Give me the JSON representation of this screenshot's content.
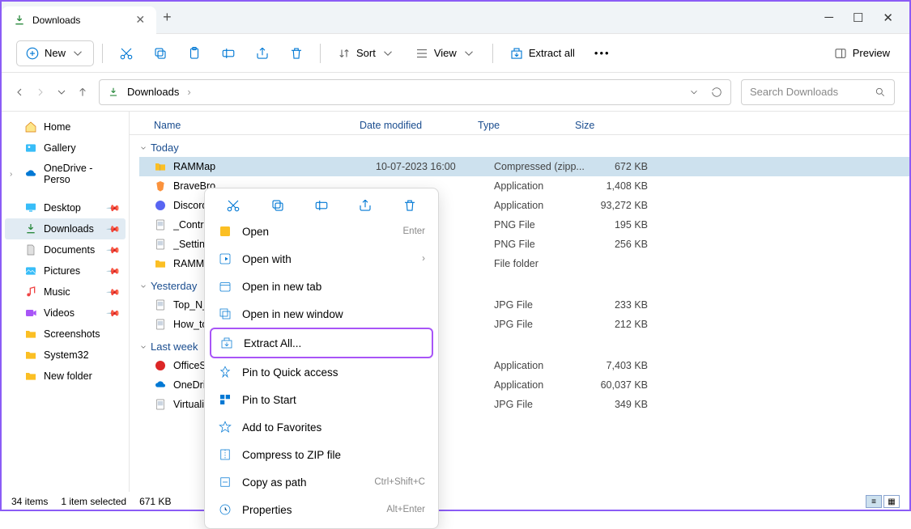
{
  "window": {
    "tab_title": "Downloads",
    "titlebar_controls": {
      "minimize": "─",
      "maximize": "☐",
      "close": "✕"
    }
  },
  "toolbar": {
    "new": "New",
    "sort": "Sort",
    "view": "View",
    "extract_all": "Extract all",
    "preview": "Preview"
  },
  "breadcrumb": {
    "path_seg": "Downloads",
    "arrow": "›"
  },
  "search": {
    "placeholder": "Search Downloads"
  },
  "sidebar": {
    "items": [
      {
        "label": "Home",
        "icon": "home-icon"
      },
      {
        "label": "Gallery",
        "icon": "gallery-icon"
      },
      {
        "label": "OneDrive - Perso",
        "icon": "onedrive-icon",
        "expandable": true
      }
    ],
    "quick": [
      {
        "label": "Desktop",
        "icon": "desktop-icon",
        "pinned": true
      },
      {
        "label": "Downloads",
        "icon": "download-icon",
        "pinned": true,
        "selected": true
      },
      {
        "label": "Documents",
        "icon": "document-icon",
        "pinned": true
      },
      {
        "label": "Pictures",
        "icon": "pictures-icon",
        "pinned": true
      },
      {
        "label": "Music",
        "icon": "music-icon",
        "pinned": true
      },
      {
        "label": "Videos",
        "icon": "videos-icon",
        "pinned": true
      },
      {
        "label": "Screenshots",
        "icon": "folder-icon"
      },
      {
        "label": "System32",
        "icon": "folder-icon"
      },
      {
        "label": "New folder",
        "icon": "folder-icon"
      }
    ]
  },
  "columns": {
    "name": "Name",
    "date": "Date modified",
    "type": "Type",
    "size": "Size"
  },
  "groups": [
    {
      "header": "Today",
      "rows": [
        {
          "name": "RAMMap",
          "date": "10-07-2023 16:00",
          "type": "Compressed (zipp...",
          "size": "672 KB",
          "icon": "zip-icon",
          "selected": true
        },
        {
          "name": "BraveBro",
          "date": "",
          "type": "Application",
          "size": "1,408 KB",
          "icon": "brave-icon"
        },
        {
          "name": "DiscordS",
          "date": "",
          "type": "Application",
          "size": "93,272 KB",
          "icon": "discord-icon"
        },
        {
          "name": "_Controll",
          "date": "",
          "type": "PNG File",
          "size": "195 KB",
          "icon": "png-icon"
        },
        {
          "name": "_Settings",
          "date": "",
          "type": "PNG File",
          "size": "256 KB",
          "icon": "png-icon"
        },
        {
          "name": "RAMMap",
          "date": "",
          "type": "File folder",
          "size": "",
          "icon": "folder-icon"
        }
      ]
    },
    {
      "header": "Yesterday",
      "rows": [
        {
          "name": "Top_N_W",
          "date": "",
          "type": "JPG File",
          "size": "233 KB",
          "icon": "png-icon"
        },
        {
          "name": "How_to_",
          "date": "",
          "type": "JPG File",
          "size": "212 KB",
          "icon": "png-icon"
        }
      ]
    },
    {
      "header": "Last week",
      "rows": [
        {
          "name": "OfficeSet",
          "date": "",
          "type": "Application",
          "size": "7,403 KB",
          "icon": "office-icon"
        },
        {
          "name": "OneDrive",
          "date": "",
          "type": "Application",
          "size": "60,037 KB",
          "icon": "onedrive-icon"
        },
        {
          "name": "Virtualiza",
          "date": "",
          "type": "JPG File",
          "size": "349 KB",
          "icon": "png-icon"
        }
      ]
    }
  ],
  "context_menu": {
    "items": [
      {
        "label": "Open",
        "hint": "Enter",
        "icon": "open-icon"
      },
      {
        "label": "Open with",
        "hint": "›",
        "icon": "openwith-icon"
      },
      {
        "label": "Open in new tab",
        "icon": "newtab-icon"
      },
      {
        "label": "Open in new window",
        "icon": "newwin-icon"
      },
      {
        "label": "Extract All...",
        "icon": "extract-icon",
        "highlight": true
      },
      {
        "label": "Pin to Quick access",
        "icon": "pin-icon"
      },
      {
        "label": "Pin to Start",
        "icon": "pinstart-icon"
      },
      {
        "label": "Add to Favorites",
        "icon": "star-icon"
      },
      {
        "label": "Compress to ZIP file",
        "icon": "zip-action-icon"
      },
      {
        "label": "Copy as path",
        "hint": "Ctrl+Shift+C",
        "icon": "copypath-icon"
      },
      {
        "label": "Properties",
        "hint": "Alt+Enter",
        "icon": "properties-icon"
      }
    ]
  },
  "status": {
    "count": "34 items",
    "selection": "1 item selected",
    "sel_size": "671 KB"
  }
}
